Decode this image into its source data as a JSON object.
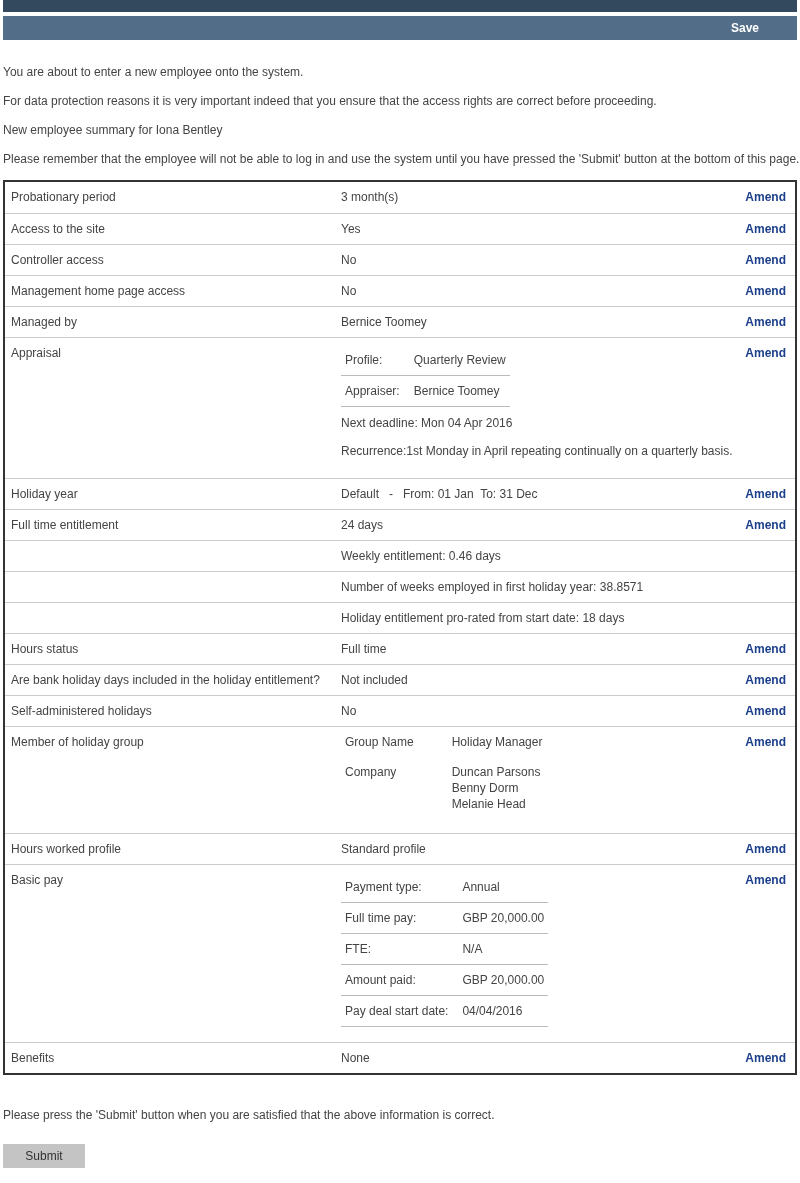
{
  "header": {
    "save_label": "Save"
  },
  "intro": [
    "You are about to enter a new employee onto the system.",
    "For data protection reasons it is very important indeed that you ensure that the access rights are correct before proceeding.",
    "New employee summary for Iona Bentley",
    "Please remember that the employee will not be able to log in and use the system until you have pressed the 'Submit' button at the bottom of this page."
  ],
  "rows": [
    {
      "kind": "text",
      "label": "Probationary period",
      "value": "3 month(s)",
      "action": "Amend"
    },
    {
      "kind": "text",
      "label": "Access to the site",
      "value": "Yes",
      "action": "Amend"
    },
    {
      "kind": "text",
      "label": "Controller access",
      "value": "No",
      "action": "Amend"
    },
    {
      "kind": "text",
      "label": "Management home page access",
      "value": "No",
      "action": "Amend"
    },
    {
      "kind": "text",
      "label": "Managed by",
      "value": "Bernice Toomey",
      "action": "Amend"
    },
    {
      "kind": "details",
      "label": "Appraisal",
      "details": [
        {
          "label": "Profile:",
          "value": "Quarterly Review"
        },
        {
          "label": "Appraiser:",
          "value": "Bernice Toomey"
        }
      ],
      "notes": [
        "Next deadline: Mon 04 Apr 2016",
        "Recurrence:1st Monday in April repeating continually on a quarterly basis."
      ],
      "action": "Amend"
    },
    {
      "kind": "text",
      "label": "Holiday year",
      "value": "Default   -   From: 01 Jan  To: 31 Dec",
      "action": "Amend"
    },
    {
      "kind": "text",
      "label": "Full time entitlement",
      "value": "24 days",
      "action": "Amend"
    },
    {
      "kind": "text",
      "value": "Weekly entitlement: 0.46 days"
    },
    {
      "kind": "text",
      "value": "Number of weeks employed in first holiday year: 38.8571"
    },
    {
      "kind": "text",
      "value": "Holiday entitlement pro-rated from start date: 18 days"
    },
    {
      "kind": "text",
      "label": "Hours status",
      "value": "Full time",
      "action": "Amend"
    },
    {
      "kind": "text",
      "label": "Are bank holiday days included in the holiday entitlement?",
      "value": "Not included",
      "action": "Amend"
    },
    {
      "kind": "text",
      "label": "Self-administered holidays",
      "value": "No",
      "action": "Amend"
    },
    {
      "kind": "group",
      "label": "Member of holiday group",
      "entries": [
        {
          "label": "Group Name",
          "values": [
            "Holiday Manager"
          ]
        },
        {
          "label": "Company",
          "values": [
            "Duncan Parsons",
            "Benny Dorm",
            "Melanie Head"
          ]
        }
      ],
      "action": "Amend"
    },
    {
      "kind": "text",
      "label": "Hours worked profile",
      "value": "Standard profile",
      "action": "Amend"
    },
    {
      "kind": "details",
      "label": "Basic pay",
      "details": [
        {
          "label": "Payment type:",
          "value": "Annual"
        },
        {
          "label": "Full time pay:",
          "value": "GBP 20,000.00"
        },
        {
          "label": "FTE:",
          "value": "N/A"
        },
        {
          "label": "Amount paid:",
          "value": "GBP 20,000.00"
        },
        {
          "label": "Pay deal start date:",
          "value": "04/04/2016"
        }
      ],
      "action": "Amend"
    },
    {
      "kind": "text",
      "label": "Benefits",
      "value": "None",
      "action": "Amend"
    }
  ],
  "footer_note": "Please press the 'Submit' button when you are satisfied that the above information is correct.",
  "submit_label": "Submit"
}
